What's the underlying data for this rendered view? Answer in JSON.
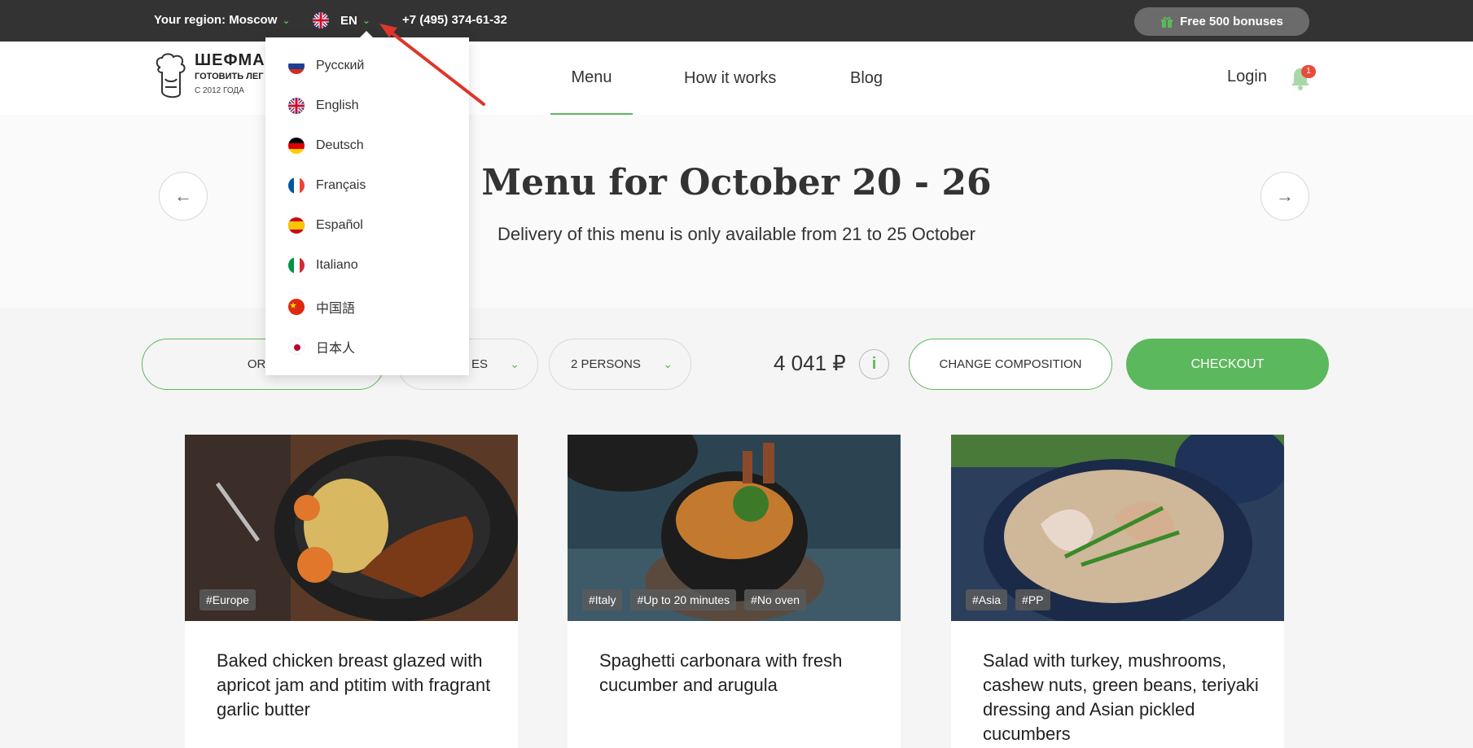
{
  "topbar": {
    "region": "Your region: Moscow",
    "language": "EN",
    "phone": "+7 (495) 374-61-32",
    "bonus": "Free 500 bonuses"
  },
  "header": {
    "logo_title": "ШЕФМАР",
    "logo_subtitle": "ГОТОВИТЬ ЛЕГ",
    "logo_since": "С 2012 ГОДА",
    "nav": [
      "Menu",
      "How it works",
      "Blog"
    ],
    "login": "Login",
    "notifications": "1"
  },
  "hero": {
    "title": "Menu for October 20 - 26",
    "subtitle": "Delivery of this menu is only available from 21 to 25 October"
  },
  "controls": {
    "menu_type": "ORIG",
    "servings": "ES",
    "persons": "2 PERSONS",
    "price": "4 041 ₽",
    "info": "i",
    "change": "CHANGE COMPOSITION",
    "checkout": "CHECKOUT"
  },
  "language_menu": {
    "items": [
      "Русский",
      "English",
      "Deutsch",
      "Français",
      "Español",
      "Italiano",
      "中国語",
      "日本人"
    ]
  },
  "cards": [
    {
      "tags": [
        "#Europe"
      ],
      "title": "Baked chicken breast glazed with apricot jam and ptitim with fragrant garlic butter"
    },
    {
      "tags": [
        "#Italy",
        "#Up to 20 minutes",
        "#No oven"
      ],
      "title": "Spaghetti carbonara with fresh cucumber and arugula"
    },
    {
      "tags": [
        "#Asia",
        "#PP"
      ],
      "title": "Salad with turkey, mushrooms, cashew nuts, green beans, teriyaki dressing and Asian pickled cucumbers"
    }
  ],
  "colors": {
    "accent": "#5cb85c",
    "topbar": "#333333",
    "badge": "#e74c3c",
    "annotation": "#e0352b"
  }
}
